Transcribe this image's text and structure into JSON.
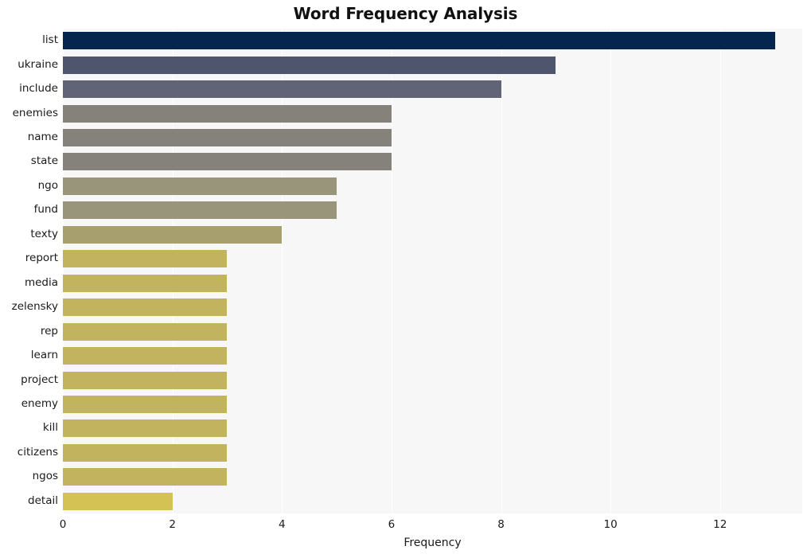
{
  "chart_data": {
    "type": "bar",
    "orientation": "horizontal",
    "title": "Word Frequency Analysis",
    "xlabel": "Frequency",
    "ylabel": "",
    "categories": [
      "list",
      "ukraine",
      "include",
      "enemies",
      "name",
      "state",
      "ngo",
      "fund",
      "texty",
      "report",
      "media",
      "zelensky",
      "rep",
      "learn",
      "project",
      "enemy",
      "kill",
      "citizens",
      "ngos",
      "detail"
    ],
    "values": [
      13,
      9,
      8,
      6,
      6,
      6,
      5,
      5,
      4,
      3,
      3,
      3,
      3,
      3,
      3,
      3,
      3,
      3,
      3,
      2
    ],
    "xticks": [
      0,
      2,
      4,
      6,
      8,
      10,
      12
    ],
    "xlim": [
      0,
      13.5
    ],
    "grid": "vertical",
    "legend": "none",
    "bar_colors": [
      "#04254e",
      "#50556e",
      "#616376",
      "#84827a",
      "#84827a",
      "#84827a",
      "#98957b",
      "#98957b",
      "#a89f6f",
      "#c2b45f",
      "#c2b45f",
      "#c2b45f",
      "#c2b45f",
      "#c2b45f",
      "#c2b45f",
      "#c2b45f",
      "#c2b45f",
      "#c2b45f",
      "#c2b45f",
      "#d4c354"
    ],
    "plot_background": "#f7f7f7",
    "figure_background": "#ffffff",
    "gridline_color": "#ffffff"
  }
}
